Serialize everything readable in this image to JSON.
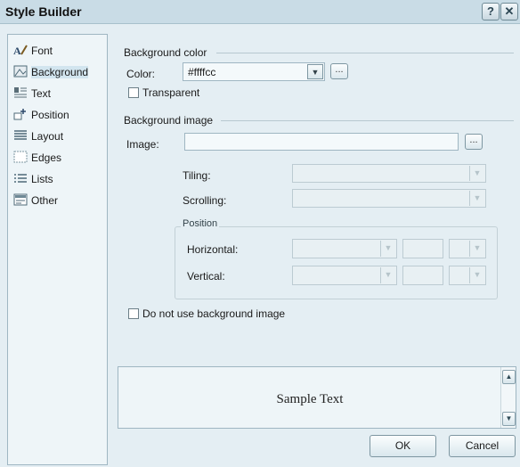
{
  "window": {
    "title": "Style Builder",
    "help_glyph": "?",
    "close_glyph": "✕"
  },
  "sidebar": {
    "items": [
      {
        "label": "Font",
        "icon": "font-icon"
      },
      {
        "label": "Background",
        "icon": "background-icon"
      },
      {
        "label": "Text",
        "icon": "text-icon"
      },
      {
        "label": "Position",
        "icon": "position-icon"
      },
      {
        "label": "Layout",
        "icon": "layout-icon"
      },
      {
        "label": "Edges",
        "icon": "edges-icon"
      },
      {
        "label": "Lists",
        "icon": "lists-icon"
      },
      {
        "label": "Other",
        "icon": "other-icon"
      }
    ],
    "selected": "Background"
  },
  "bgcolor": {
    "group": "Background color",
    "color_label": "Color:",
    "color_value": "#ffffcc",
    "browse": "...",
    "transparent_label": "Transparent"
  },
  "bgimage": {
    "group": "Background image",
    "image_label": "Image:",
    "image_value": "",
    "browse": "...",
    "tiling_label": "Tiling:",
    "scrolling_label": "Scrolling:",
    "position_group": "Position",
    "horizontal_label": "Horizontal:",
    "vertical_label": "Vertical:",
    "no_image_label": "Do not use background image"
  },
  "preview": {
    "sample": "Sample Text"
  },
  "buttons": {
    "ok": "OK",
    "cancel": "Cancel"
  },
  "colors": {
    "accent": "#c9dce6",
    "surface": "#e4eef3"
  }
}
